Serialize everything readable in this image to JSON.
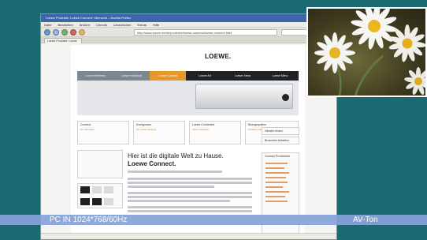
{
  "browser": {
    "title": "Loewe Produkte: Loewe Connect: Übersicht – Mozilla Firefox",
    "menu": [
      "Datei",
      "Bearbeiten",
      "Ansicht",
      "Chronik",
      "Lesezeichen",
      "Extras",
      "Hilfe"
    ],
    "url": "http://www.loewe.de/de/produkte/loewe-connect/loewe-connect.html",
    "tab_label": "Loewe Produkte: Loewe"
  },
  "website": {
    "logo": "LOEWE.",
    "nav": [
      "Loewe Referenz",
      "Loewe Individual",
      "Loewe Connect",
      "Loewe Art",
      "Loewe Xelos",
      "Loewe Mimo"
    ],
    "info_boxes": [
      "Connect",
      "Konfigurator",
      "Loewe Connected",
      "Bezugsquellen"
    ],
    "info_box_sub": [
      "Zur Übersicht",
      "Ihr Loewe Connect",
      "Jetzt entdecken",
      "Händler finden"
    ],
    "headline": "Hier ist die digitale Welt zu Hause.",
    "subheadline": "Loewe Connect.",
    "side_links": [
      "Händler finden",
      "Broschüre bestellen"
    ],
    "side_title": "Connect Produktlinie"
  },
  "osd": {
    "input_label": "PC IN 1024*768/60Hz",
    "audio_label": "AV-Ton"
  },
  "colors": {
    "background": "#1b6a72",
    "infobar": "#84a3d8",
    "nav_active": "#e7982a"
  }
}
